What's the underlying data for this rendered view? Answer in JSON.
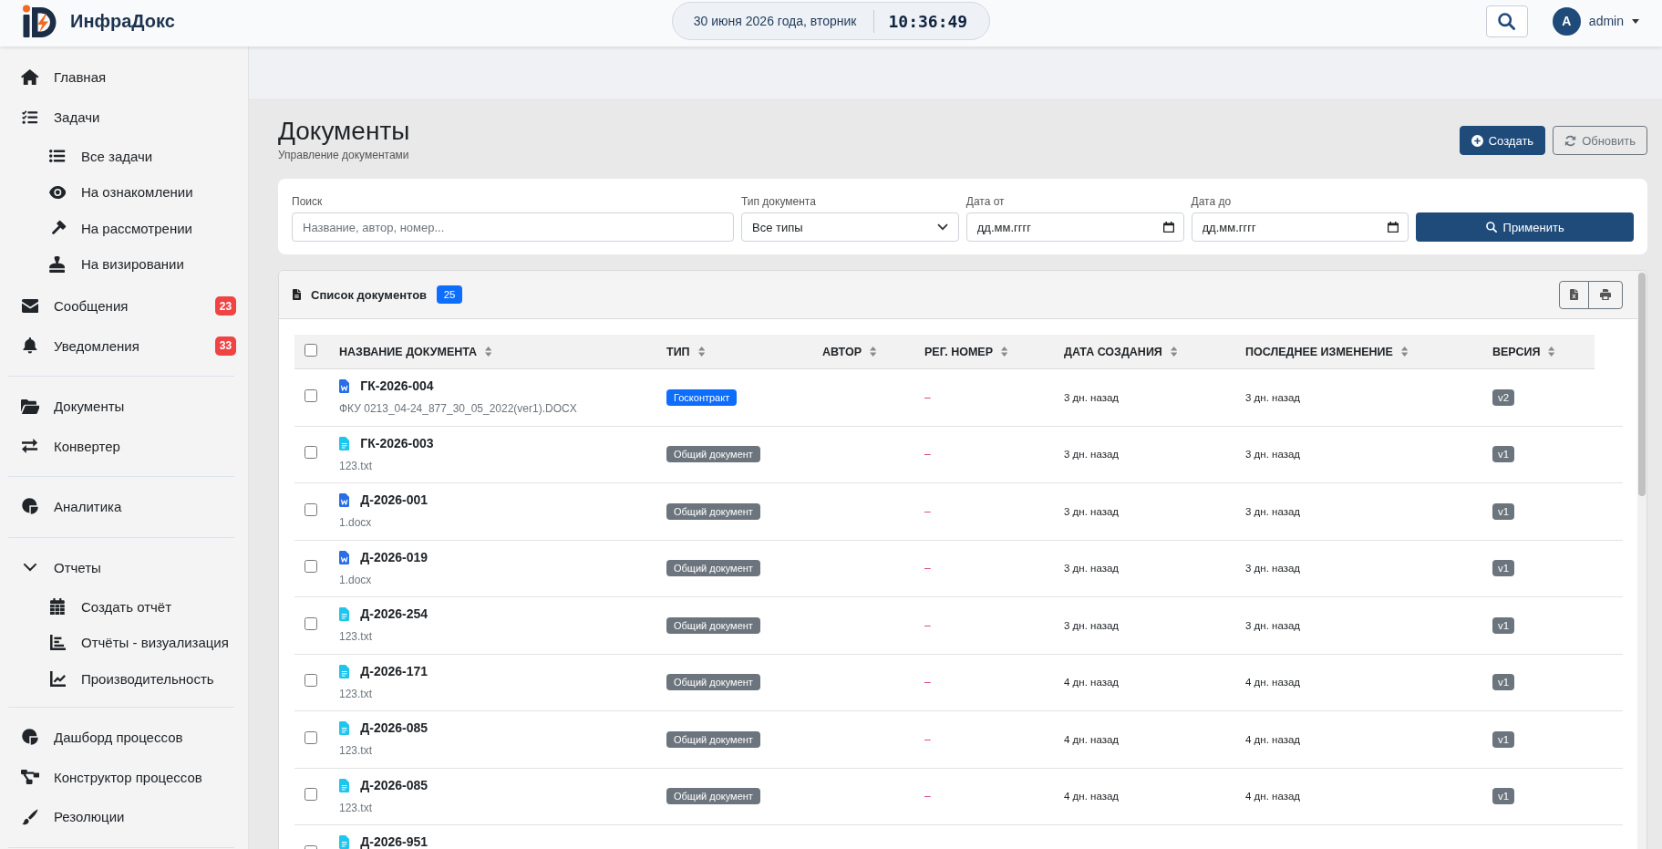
{
  "header": {
    "app_title": "ИнфраДокс",
    "date": "30 июня 2026 года, вторник",
    "time": "10:36:49",
    "user": {
      "initial": "A",
      "name": "admin"
    }
  },
  "sidebar": {
    "groups": [
      {
        "items": [
          {
            "label": "Главная"
          },
          {
            "label": "Задачи",
            "children": [
              {
                "label": "Все задачи"
              },
              {
                "label": "На ознакомлении"
              },
              {
                "label": "На рассмотрении"
              },
              {
                "label": "На визировании"
              }
            ]
          },
          {
            "label": "Сообщения",
            "badge": "23"
          },
          {
            "label": "Уведомления",
            "badge": "33"
          }
        ]
      },
      {
        "items": [
          {
            "label": "Документы"
          },
          {
            "label": "Конвертер"
          }
        ]
      },
      {
        "items": [
          {
            "label": "Аналитика"
          }
        ]
      },
      {
        "items": [
          {
            "label": "Отчеты",
            "expanded": true,
            "children": [
              {
                "label": "Создать отчёт"
              },
              {
                "label": "Отчёты - визуализация"
              },
              {
                "label": "Производительность"
              }
            ]
          }
        ]
      },
      {
        "items": [
          {
            "label": "Дашборд процессов"
          },
          {
            "label": "Конструктор процессов"
          },
          {
            "label": "Резолюции"
          }
        ]
      }
    ]
  },
  "page": {
    "title": "Документы",
    "subtitle": "Управление документами",
    "actions": [
      {
        "label": "Создать",
        "kind": "primary"
      },
      {
        "label": "Обновить",
        "kind": "secondary"
      }
    ]
  },
  "filters": {
    "search": {
      "label": "Поиск",
      "placeholder": "Название, автор, номер..."
    },
    "type": {
      "label": "Тип документа",
      "value": "Все типы"
    },
    "date_from": {
      "label": "Дата от",
      "placeholder": "дд.мм.гггг"
    },
    "date_to": {
      "label": "Дата до",
      "placeholder": "дд.мм.гггг"
    },
    "apply": "Применить"
  },
  "documents": {
    "title": "Список документов",
    "count": "25",
    "table": {
      "select_all": {
        "checked": false
      },
      "columns": [
        "НАЗВАНИЕ ДОКУМЕНТА",
        "ТИП",
        "АВТОР",
        "РЕГ. НОМЕР",
        "ДАТА СОЗДАНИЯ",
        "ПОСЛЕДНЕЕ ИЗМЕНЕНИЕ",
        "ВЕРСИЯ"
      ],
      "rows": [
        {
          "checked": false,
          "kind": "word",
          "name": "ГК-2026-004",
          "file": "ФКУ 0213_04-24_877_30_05_2022(ver1).DOCX",
          "type": {
            "label": "Госконтракт",
            "color": "#0d6efd"
          },
          "reg_number": "–",
          "created": "3 дн. назад",
          "modified": "3 дн. назад",
          "version": "v2"
        },
        {
          "checked": false,
          "kind": "text",
          "name": "ГК-2026-003",
          "file": "123.txt",
          "type": {
            "label": "Общий документ",
            "color": "#6c757d"
          },
          "reg_number": "–",
          "created": "3 дн. назад",
          "modified": "3 дн. назад",
          "version": "v1"
        },
        {
          "checked": false,
          "kind": "word",
          "name": "Д-2026-001",
          "file": "1.docx",
          "type": {
            "label": "Общий документ",
            "color": "#6c757d"
          },
          "reg_number": "–",
          "created": "3 дн. назад",
          "modified": "3 дн. назад",
          "version": "v1"
        },
        {
          "checked": false,
          "kind": "word",
          "name": "Д-2026-019",
          "file": "1.docx",
          "type": {
            "label": "Общий документ",
            "color": "#6c757d"
          },
          "reg_number": "–",
          "created": "3 дн. назад",
          "modified": "3 дн. назад",
          "version": "v1"
        },
        {
          "checked": false,
          "kind": "text",
          "name": "Д-2026-254",
          "file": "123.txt",
          "type": {
            "label": "Общий документ",
            "color": "#6c757d"
          },
          "reg_number": "–",
          "created": "3 дн. назад",
          "modified": "3 дн. назад",
          "version": "v1"
        },
        {
          "checked": false,
          "kind": "text",
          "name": "Д-2026-171",
          "file": "123.txt",
          "type": {
            "label": "Общий документ",
            "color": "#6c757d"
          },
          "reg_number": "–",
          "created": "4 дн. назад",
          "modified": "4 дн. назад",
          "version": "v1"
        },
        {
          "checked": false,
          "kind": "text",
          "name": "Д-2026-085",
          "file": "123.txt",
          "type": {
            "label": "Общий документ",
            "color": "#6c757d"
          },
          "reg_number": "–",
          "created": "4 дн. назад",
          "modified": "4 дн. назад",
          "version": "v1"
        },
        {
          "checked": false,
          "kind": "text",
          "name": "Д-2026-085",
          "file": "123.txt",
          "type": {
            "label": "Общий документ",
            "color": "#6c757d"
          },
          "reg_number": "–",
          "created": "4 дн. назад",
          "modified": "4 дн. назад",
          "version": "v1"
        },
        {
          "checked": false,
          "kind": "text",
          "name": "Д-2026-951"
        }
      ]
    }
  }
}
